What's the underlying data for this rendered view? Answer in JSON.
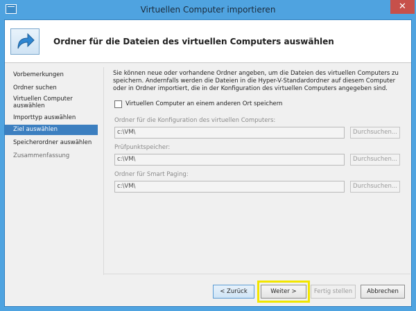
{
  "window": {
    "title": "Virtuellen Computer importieren",
    "close_glyph": "✕",
    "accent_color": "#4fa3e0"
  },
  "header": {
    "title": "Ordner für die Dateien des virtuellen Computers auswählen",
    "icon": "arrow-forward-icon"
  },
  "nav": {
    "items": [
      {
        "label": "Vorbemerkungen",
        "state": "normal"
      },
      {
        "label": "Ordner suchen",
        "state": "normal"
      },
      {
        "label": "Virtuellen Computer auswählen",
        "state": "normal"
      },
      {
        "label": "Importtyp auswählen",
        "state": "normal"
      },
      {
        "label": "Ziel auswählen",
        "state": "active"
      },
      {
        "label": "Speicherordner auswählen",
        "state": "normal"
      },
      {
        "label": "Zusammenfassung",
        "state": "disabled"
      }
    ]
  },
  "content": {
    "intro": "Sie können neue oder vorhandene Ordner angeben, um die Dateien des virtuellen Computers zu speichern. Andernfalls werden die Dateien in die Hyper-V-Standardordner auf diesem Computer oder in Ordner importiert, die in der Konfiguration des virtuellen Computers angegeben sind.",
    "checkbox_label": "Virtuellen Computer an einem anderen Ort speichern",
    "checkbox_checked": false,
    "fields": [
      {
        "label": "Ordner für die Konfiguration des virtuellen Computers:",
        "value": "c:\\VM\\",
        "button": "Durchsuchen..."
      },
      {
        "label": "Prüfpunktspeicher:",
        "value": "c:\\VM\\",
        "button": "Durchsuchen..."
      },
      {
        "label": "Ordner für Smart Paging:",
        "value": "c:\\VM\\",
        "button": "Durchsuchen..."
      }
    ]
  },
  "footer": {
    "back": "< Zurück",
    "next": "Weiter >",
    "finish": "Fertig stellen",
    "cancel": "Abbrechen",
    "highlight_color": "#f2e600"
  }
}
